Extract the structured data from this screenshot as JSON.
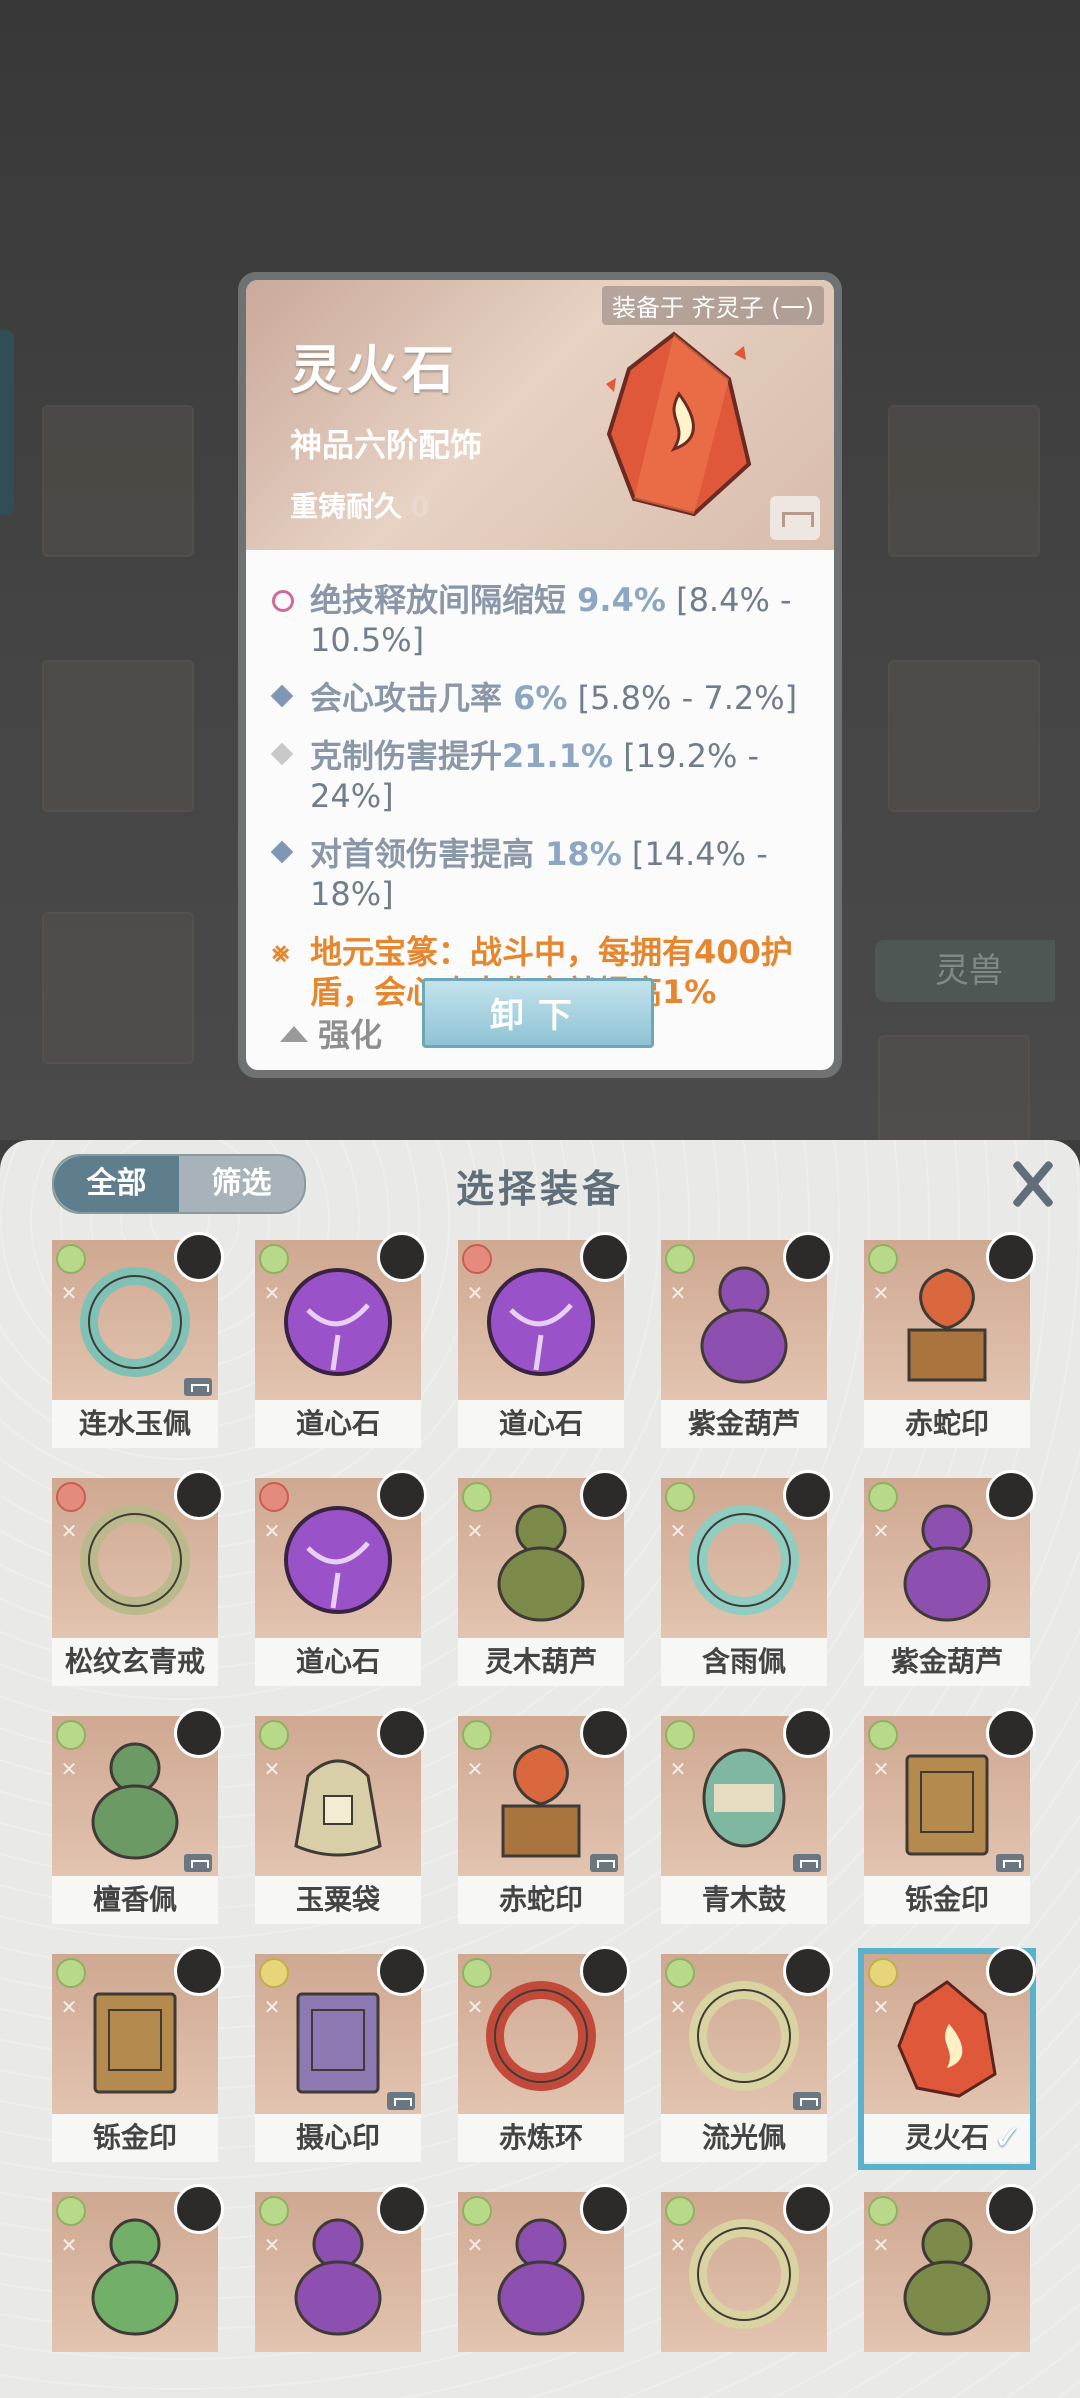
{
  "background": {
    "tab_label": "灵兽"
  },
  "detail": {
    "equipped_on": "装备于 齐灵子 (一)",
    "name": "灵火石",
    "grade": "神品六阶配饰",
    "durability_label": "重铸耐久",
    "durability_value": "0",
    "stats": [
      {
        "text": "绝技释放间隔缩短 ",
        "value": "9.4%",
        "range": " [8.4% - 10.5%]",
        "bullet": "pink"
      },
      {
        "text": "会心攻击几率 ",
        "value": "6%",
        "range": " [5.8% - 7.2%]",
        "bullet": "blue"
      },
      {
        "text": "克制伤害提升",
        "value": "21.1%",
        "range": " [19.2% - 24%]",
        "bullet": "grey"
      },
      {
        "text": "对首领伤害提高 ",
        "value": "18%",
        "range": " [14.4% - 18%]",
        "bullet": "blue"
      }
    ],
    "special": "地元宝篆：战斗中，每拥有400护盾，会心攻击伤害就提高1%",
    "strengthen_label": "强化",
    "unload_label": "卸下"
  },
  "panel": {
    "tabs": {
      "all": "全部",
      "filter": "筛选"
    },
    "title": "选择装备",
    "items": [
      {
        "name": "连水玉佩",
        "rank": "green",
        "tag": true,
        "art": "ring",
        "color": "#7fc1b5"
      },
      {
        "name": "道心石",
        "rank": "green",
        "tag": false,
        "art": "orb",
        "color": "#9a52c8"
      },
      {
        "name": "道心石",
        "rank": "red",
        "tag": false,
        "art": "orb",
        "color": "#9a52c8"
      },
      {
        "name": "紫金葫芦",
        "rank": "green",
        "tag": false,
        "art": "gourd",
        "color": "#8d4fb0"
      },
      {
        "name": "赤蛇印",
        "rank": "green",
        "tag": false,
        "art": "seal",
        "color": "#d9683e"
      },
      {
        "name": "松纹玄青戒",
        "rank": "red",
        "tag": false,
        "art": "ring",
        "color": "#b9b98c"
      },
      {
        "name": "道心石",
        "rank": "red",
        "tag": false,
        "art": "orb",
        "color": "#9a52c8"
      },
      {
        "name": "灵木葫芦",
        "rank": "green",
        "tag": false,
        "art": "gourd",
        "color": "#7c8a4a"
      },
      {
        "name": "含雨佩",
        "rank": "green",
        "tag": false,
        "art": "ring",
        "color": "#8fcdc0"
      },
      {
        "name": "紫金葫芦",
        "rank": "green",
        "tag": false,
        "art": "gourd",
        "color": "#8d4fb0"
      },
      {
        "name": "檀香佩",
        "rank": "green",
        "tag": true,
        "art": "gourd",
        "color": "#6b9a64"
      },
      {
        "name": "玉粟袋",
        "rank": "green",
        "tag": false,
        "art": "bag",
        "color": "#d8cfa8"
      },
      {
        "name": "赤蛇印",
        "rank": "green",
        "tag": true,
        "art": "seal",
        "color": "#d9683e"
      },
      {
        "name": "青木鼓",
        "rank": "green",
        "tag": true,
        "art": "drum",
        "color": "#7fb7a2"
      },
      {
        "name": "铄金印",
        "rank": "green",
        "tag": true,
        "art": "box",
        "color": "#b58a4e"
      },
      {
        "name": "铄金印",
        "rank": "green",
        "tag": false,
        "art": "box",
        "color": "#b58a4e"
      },
      {
        "name": "摄心印",
        "rank": "yellow",
        "tag": true,
        "art": "box",
        "color": "#8d7ab3"
      },
      {
        "name": "赤炼环",
        "rank": "green",
        "tag": false,
        "art": "ring",
        "color": "#c24a3a"
      },
      {
        "name": "流光佩",
        "rank": "green",
        "tag": true,
        "art": "ring",
        "color": "#d8d3a0"
      },
      {
        "name": "灵火石",
        "rank": "yellow",
        "tag": false,
        "art": "stone",
        "color": "#e0583a",
        "selected": true
      },
      {
        "name": "",
        "rank": "green",
        "tag": false,
        "art": "gourd",
        "color": "#72b06a"
      },
      {
        "name": "",
        "rank": "green",
        "tag": false,
        "art": "gourd",
        "color": "#8d4fb0"
      },
      {
        "name": "",
        "rank": "green",
        "tag": false,
        "art": "gourd",
        "color": "#8d4fb0"
      },
      {
        "name": "",
        "rank": "green",
        "tag": false,
        "art": "ring",
        "color": "#d8d3a0"
      },
      {
        "name": "",
        "rank": "green",
        "tag": false,
        "art": "gourd",
        "color": "#7c8a4a"
      }
    ]
  }
}
